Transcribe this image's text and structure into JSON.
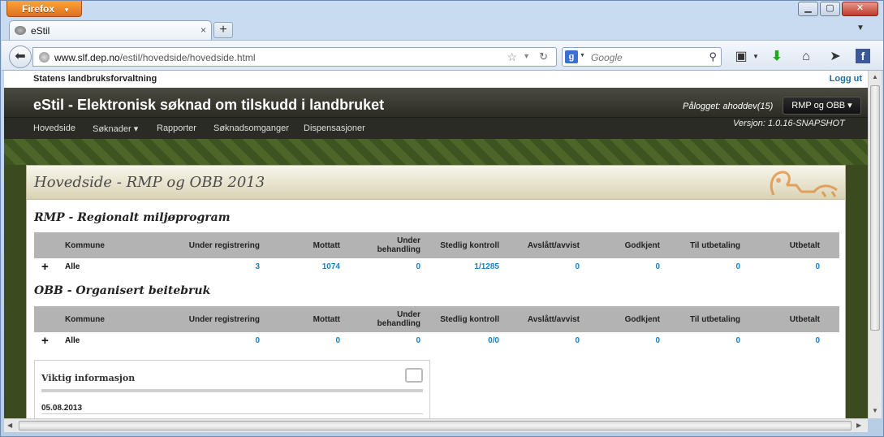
{
  "browser": {
    "app_button": "Firefox",
    "tab_title": "eStil",
    "address_domain": "www.slf.dep.no",
    "address_path": "/estil/hovedside/hovedside.html",
    "search_placeholder": "Google",
    "search_engine_letter": "g"
  },
  "site": {
    "org": "Statens landbruksforvaltning",
    "logout": "Logg ut",
    "app_title": "eStil - Elektronisk søknad om tilskudd i landbruket",
    "logged_in": "Pålogget: ahoddev(15)",
    "scheme_button": "RMP og OBB ▾",
    "version": "Versjon: 1.0.16-SNAPSHOT",
    "menu": [
      "Hovedside",
      "Søknader ▾",
      "Rapporter",
      "Søknadsomganger",
      "Dispensasjoner"
    ]
  },
  "panel": {
    "heading": "Hovedside - RMP og OBB 2013"
  },
  "columns": [
    "Kommune",
    "Under registrering",
    "Mottatt",
    "Under behandling",
    "Stedlig kontroll",
    "Avslått/avvist",
    "Godkjent",
    "Til utbetaling",
    "Utbetalt"
  ],
  "rmp": {
    "title": "RMP - Regionalt miljøprogram",
    "row": {
      "expand": "+",
      "kommune": "Alle",
      "values": [
        "3",
        "1074",
        "0",
        "1/1285",
        "0",
        "0",
        "0",
        "0"
      ]
    }
  },
  "obb": {
    "title": "OBB - Organisert beitebruk",
    "row": {
      "expand": "+",
      "kommune": "Alle",
      "values": [
        "0",
        "0",
        "0",
        "0/0",
        "0",
        "0",
        "0",
        "0"
      ]
    }
  },
  "info": {
    "heading": "Viktig informasjon",
    "date": "05.08.2013"
  }
}
